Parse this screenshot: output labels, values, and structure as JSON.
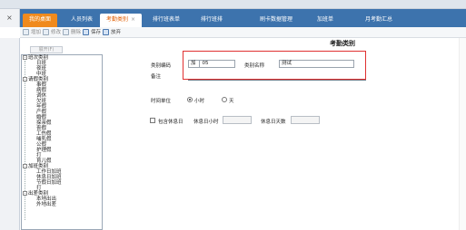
{
  "left_edge": {
    "close_glyph": "×"
  },
  "tabs": [
    {
      "label": "我的桌面",
      "style": "orange"
    },
    {
      "label": "人员列表",
      "style": "plain"
    },
    {
      "label": "考勤类别",
      "style": "active",
      "close": "×"
    },
    {
      "label": "排行班表单",
      "style": "plain"
    },
    {
      "label": "排行班排",
      "style": "plain"
    },
    {
      "label": "刷卡数据管理",
      "style": "plain"
    },
    {
      "label": "加班单",
      "style": "plain"
    },
    {
      "label": "月考勤汇总",
      "style": "plain"
    }
  ],
  "toolbar": [
    {
      "label": "增加",
      "icon": "add-icon",
      "enabled": false
    },
    {
      "label": "修改",
      "icon": "edit-icon",
      "enabled": false
    },
    {
      "label": "删除",
      "icon": "delete-icon",
      "enabled": false
    },
    {
      "label": "保存",
      "icon": "save-icon",
      "enabled": true
    },
    {
      "label": "放弃",
      "icon": "discard-icon",
      "enabled": true
    }
  ],
  "tree_button": "展开(F)",
  "tree": [
    {
      "label": "班次类别",
      "level": 0,
      "group": true,
      "exp": "-"
    },
    {
      "label": "日班",
      "level": 1
    },
    {
      "label": "夜班",
      "level": 1
    },
    {
      "label": "中班",
      "level": 1
    },
    {
      "label": "请假类别",
      "level": 0,
      "group": true,
      "exp": "-"
    },
    {
      "label": "事假",
      "level": 1
    },
    {
      "label": "病假",
      "level": 1
    },
    {
      "label": "调休",
      "level": 1
    },
    {
      "label": "欠班",
      "level": 1
    },
    {
      "label": "年假",
      "level": 1
    },
    {
      "label": "产假",
      "level": 1
    },
    {
      "label": "婚假",
      "level": 1
    },
    {
      "label": "探亲假",
      "level": 1
    },
    {
      "label": "丧假",
      "level": 1
    },
    {
      "label": "工伤假",
      "level": 1
    },
    {
      "label": "哺乳假",
      "level": 1
    },
    {
      "label": "公假",
      "level": 1
    },
    {
      "label": "护理假",
      "level": 1
    },
    {
      "label": "打",
      "level": 1
    },
    {
      "label": "育儿假",
      "level": 1
    },
    {
      "label": "加班类别",
      "level": 0,
      "group": true,
      "exp": "-"
    },
    {
      "label": "工作日加班",
      "level": 1
    },
    {
      "label": "休息日加班",
      "level": 1
    },
    {
      "label": "节假日加班",
      "level": 1
    },
    {
      "label": "打",
      "level": 1
    },
    {
      "label": "出差类别",
      "level": 0,
      "group": true,
      "exp": "-"
    },
    {
      "label": "本地出出",
      "level": 1
    },
    {
      "label": "外地出差",
      "level": 1
    }
  ],
  "form": {
    "title": "考勤类别",
    "code_label": "类别编码",
    "code_prefix": "加",
    "code_value": "05",
    "name_label": "类别名称",
    "name_value": "测试",
    "remark_label": "备注",
    "remark_value": "",
    "unit_label": "时间单位",
    "unit_hour": "小时",
    "unit_day": "天",
    "unit_selected": "小时",
    "include_rest_label": "包含休息日",
    "include_rest_checked": false,
    "rest_hours_label": "休息日小时",
    "rest_hours_value": "",
    "rest_days_label": "休息日天数",
    "rest_days_value": ""
  }
}
